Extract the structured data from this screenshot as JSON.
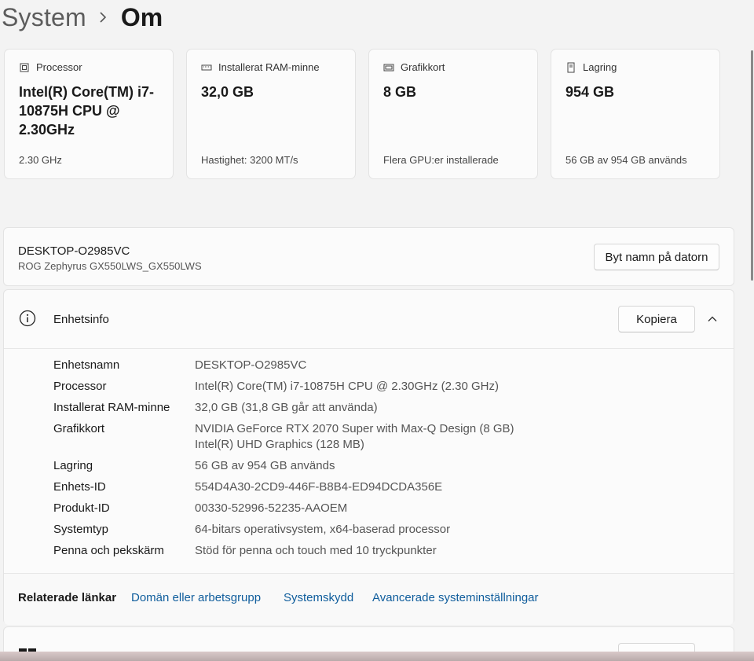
{
  "breadcrumb": {
    "parent": "System",
    "current": "Om"
  },
  "spec_cards": [
    {
      "heading": "Processor",
      "value": "Intel(R) Core(TM) i7-10875H CPU @ 2.30GHz",
      "sub": "2.30 GHz",
      "icon": "processor-icon"
    },
    {
      "heading": "Installerat RAM-minne",
      "value": "32,0 GB",
      "sub": "Hastighet: 3200 MT/s",
      "icon": "memory-icon"
    },
    {
      "heading": "Grafikkort",
      "value": "8 GB",
      "sub": "Flera GPU:er installerade",
      "icon": "gpu-icon"
    },
    {
      "heading": "Lagring",
      "value": "954 GB",
      "sub": "56 GB av 954 GB används",
      "icon": "storage-icon"
    }
  ],
  "device": {
    "name": "DESKTOP-O2985VC",
    "model": "ROG Zephyrus GX550LWS_GX550LWS",
    "rename_label": "Byt namn på datorn"
  },
  "device_info": {
    "title": "Enhetsinfo",
    "copy_label": "Kopiera",
    "rows": [
      {
        "key": "Enhetsnamn",
        "value": "DESKTOP-O2985VC"
      },
      {
        "key": "Processor",
        "value": "Intel(R) Core(TM) i7-10875H CPU @ 2.30GHz (2.30 GHz)"
      },
      {
        "key": "Installerat RAM-minne",
        "value": "32,0 GB (31,8 GB går att använda)"
      },
      {
        "key": "Grafikkort",
        "value": "NVIDIA GeForce RTX 2070 Super with Max-Q Design (8 GB)",
        "value2": "Intel(R) UHD Graphics (128 MB)"
      },
      {
        "key": "Lagring",
        "value": "56 GB av 954 GB används"
      },
      {
        "key": "Enhets-ID",
        "value": "554D4A30-2CD9-446F-B8B4-ED94DCDA356E"
      },
      {
        "key": "Produkt-ID",
        "value": "00330-52996-52235-AAOEM"
      },
      {
        "key": "Systemtyp",
        "value": "64-bitars operativsystem, x64-baserad processor"
      },
      {
        "key": "Penna och pekskärm",
        "value": "Stöd för penna och touch med 10 tryckpunkter"
      }
    ]
  },
  "related": {
    "label": "Relaterade länkar",
    "links": [
      "Domän eller arbetsgrupp",
      "Systemskydd",
      "Avancerade systeminställningar"
    ]
  },
  "colors": {
    "link": "#0f5d9c",
    "background": "#f3f3f3",
    "card": "#fbfbfb"
  }
}
